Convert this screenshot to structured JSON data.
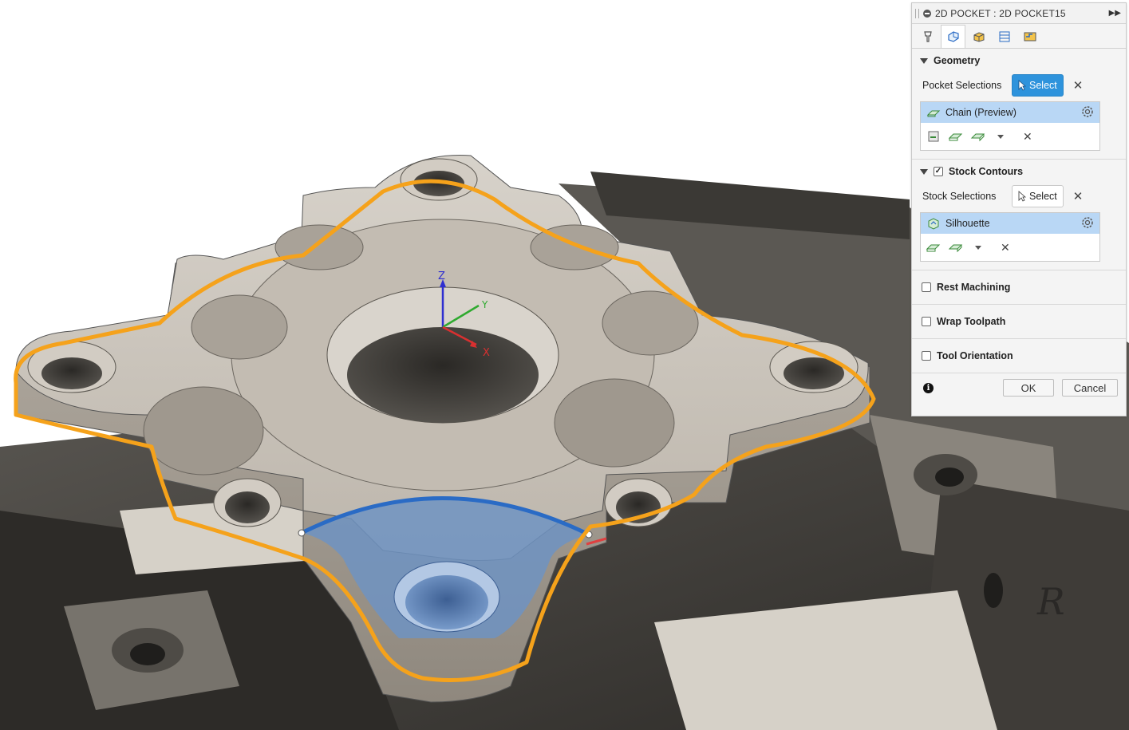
{
  "panel": {
    "title": "2D POCKET : 2D POCKET15",
    "tabs": [
      "tool-icon",
      "geometry-icon",
      "heights-icon",
      "passes-icon",
      "linking-icon"
    ],
    "active_tab": 1,
    "geometry": {
      "header": "Geometry",
      "pocket_selections_label": "Pocket Selections",
      "select_label": "Select",
      "selection_item": "Chain (Preview)"
    },
    "stock": {
      "header": "Stock Contours",
      "checked": true,
      "stock_selections_label": "Stock Selections",
      "select_label": "Select",
      "selection_item": "Silhouette"
    },
    "options": [
      {
        "label": "Rest Machining",
        "checked": false
      },
      {
        "label": "Wrap Toolpath",
        "checked": false
      },
      {
        "label": "Tool Orientation",
        "checked": false
      }
    ],
    "ok_label": "OK",
    "cancel_label": "Cancel"
  },
  "viewport": {
    "axis_labels": {
      "z": "Z",
      "y": "Y",
      "x": "X"
    },
    "vise_marking": "R",
    "colors": {
      "part": "#c9c3ba",
      "part_shadow": "#a8a198",
      "fixture": "#4a4743",
      "stock_contour": "#f5a21b",
      "pocket_fill": "#6f93c2",
      "pocket_edge": "#2a6bc5",
      "selection_blue": "#b9d7f5",
      "select_button": "#2e93dc"
    }
  }
}
